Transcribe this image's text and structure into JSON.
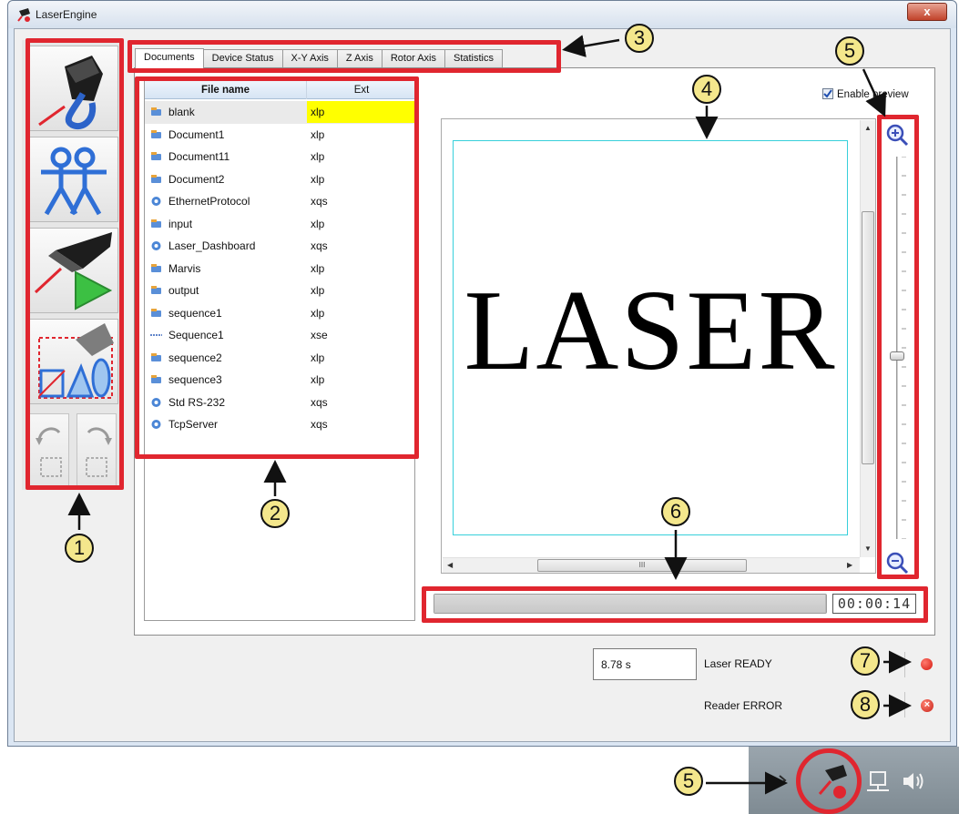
{
  "window": {
    "title": "LaserEngine",
    "close_label": "x"
  },
  "toolbar": {
    "buttons": [
      "laser-marking-button",
      "users-button",
      "run-button",
      "layout-button"
    ]
  },
  "tabs": [
    "Documents",
    "Device Status",
    "X-Y Axis",
    "Z Axis",
    "Rotor Axis",
    "Statistics"
  ],
  "file_list": {
    "headers": {
      "name": "File name",
      "ext": "Ext"
    },
    "rows": [
      {
        "name": "blank",
        "ext": "xlp",
        "icon": "document-icon"
      },
      {
        "name": "Document1",
        "ext": "xlp",
        "icon": "document-icon"
      },
      {
        "name": "Document11",
        "ext": "xlp",
        "icon": "document-icon"
      },
      {
        "name": "Document2",
        "ext": "xlp",
        "icon": "document-icon"
      },
      {
        "name": "EthernetProtocol",
        "ext": "xqs",
        "icon": "gear-icon"
      },
      {
        "name": "input",
        "ext": "xlp",
        "icon": "document-icon"
      },
      {
        "name": "Laser_Dashboard",
        "ext": "xqs",
        "icon": "gear-icon"
      },
      {
        "name": "Marvis",
        "ext": "xlp",
        "icon": "document-icon"
      },
      {
        "name": "output",
        "ext": "xlp",
        "icon": "document-icon"
      },
      {
        "name": "sequence1",
        "ext": "xlp",
        "icon": "document-icon"
      },
      {
        "name": "Sequence1",
        "ext": "xse",
        "icon": "sequence-icon"
      },
      {
        "name": "sequence2",
        "ext": "xlp",
        "icon": "document-icon"
      },
      {
        "name": "sequence3",
        "ext": "xlp",
        "icon": "document-icon"
      },
      {
        "name": "Std RS-232",
        "ext": "xqs",
        "icon": "gear-icon"
      },
      {
        "name": "TcpServer",
        "ext": "xqs",
        "icon": "gear-icon"
      }
    ]
  },
  "preview": {
    "enable_label": "Enable preview",
    "enabled": true,
    "text": "LASER",
    "scroll_mark": "III"
  },
  "progress": {
    "value": 1.0,
    "timer": "00:00:14"
  },
  "status": {
    "time": "8.78 s",
    "laser": "Laser READY",
    "reader": "Reader ERROR",
    "laser_color": "#d4170e",
    "reader_color": "#d4170e"
  },
  "callouts": [
    "1",
    "2",
    "3",
    "4",
    "5",
    "6",
    "5",
    "7",
    "8"
  ],
  "colors": {
    "accent_red": "#e0262f",
    "callout_fill": "#f4e78c",
    "highlight": "#ffff00",
    "canvas_border": "#37d0db"
  }
}
